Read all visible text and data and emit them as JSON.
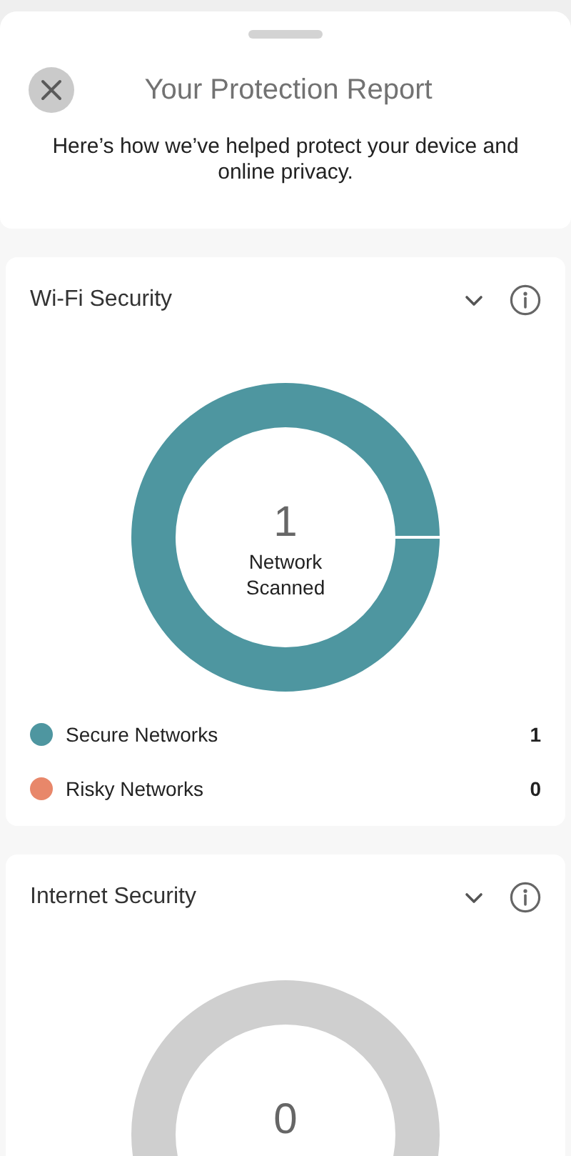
{
  "header": {
    "title": "Your Protection Report",
    "subtitle": "Here’s how we’ve helped protect your device and online privacy."
  },
  "sections": [
    {
      "title": "Wi-Fi Security",
      "expanded": false,
      "center_value": "1",
      "center_label": "Network Scanned",
      "legend": [
        {
          "label": "Secure Networks",
          "count": "1",
          "color": "#4e96a0"
        },
        {
          "label": "Risky Networks",
          "count": "0",
          "color": "#e8876a"
        }
      ]
    },
    {
      "title": "Internet Security",
      "expanded": false,
      "center_value": "0"
    }
  ]
}
